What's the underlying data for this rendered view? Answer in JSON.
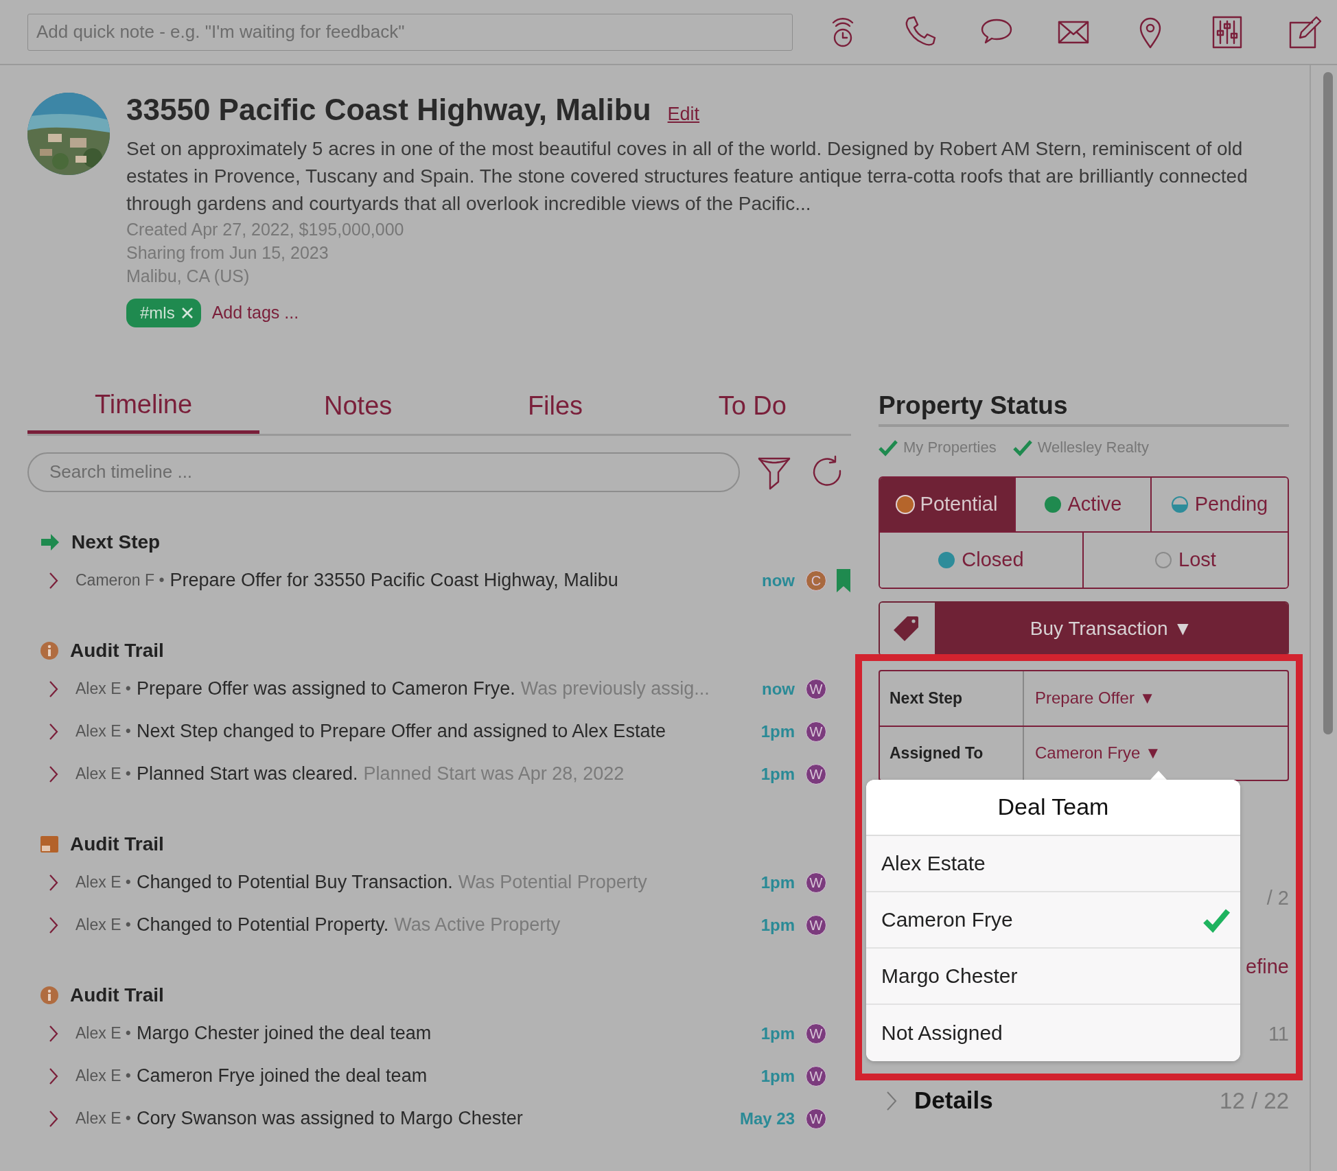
{
  "quick_note": {
    "placeholder": "Add quick note - e.g. \"I'm waiting for feedback\""
  },
  "property": {
    "title": "33550 Pacific Coast Highway, Malibu",
    "edit_link": "Edit",
    "description": "Set on approximately 5 acres in one of the most beautiful coves in all of the world. Designed by Robert AM Stern, reminiscent of old estates in Provence, Tuscany and Spain. The stone covered structures feature antique terra-cotta roofs that are brilliantly connected through gardens and courtyards that all overlook incredible views of the Pacific...",
    "meta": [
      "Created Apr 27, 2022, $195,000,000",
      "Sharing from Jun 15, 2023",
      "Malibu, CA (US)"
    ],
    "tags": [
      {
        "label": "#mls"
      }
    ],
    "add_tags": "Add tags ..."
  },
  "tabs": [
    {
      "label": "Timeline",
      "selected": true
    },
    {
      "label": "Notes",
      "selected": false
    },
    {
      "label": "Files",
      "selected": false
    },
    {
      "label": "To Do",
      "selected": false
    }
  ],
  "search": {
    "placeholder": "Search timeline ..."
  },
  "timeline": [
    {
      "kind": "next_step",
      "title": "Next Step",
      "rows": [
        {
          "author": "Cameron F •",
          "text": "Prepare Offer for 33550 Pacific Coast Highway, Malibu",
          "time": "now",
          "avatar": "C",
          "color": "#a8693f",
          "bookmarked": true
        }
      ]
    },
    {
      "kind": "info",
      "title": "Audit Trail",
      "rows": [
        {
          "author": "Alex E •",
          "text": "Prepare Offer was assigned to Cameron Frye.",
          "note": "Was previously assig...",
          "time": "now",
          "avatar": "W",
          "color": "#7b3b7d",
          "bookmarked": false
        },
        {
          "author": "Alex E •",
          "text": "Next Step changed to Prepare Offer and assigned to Alex Estate",
          "time": "1pm",
          "avatar": "W",
          "color": "#7b3b7d",
          "bookmarked": false
        },
        {
          "author": "Alex E •",
          "text": "Planned Start was cleared.",
          "note": "Planned Start was Apr 28, 2022",
          "time": "1pm",
          "avatar": "W",
          "color": "#7b3b7d",
          "bookmarked": false
        }
      ]
    },
    {
      "kind": "card",
      "title": "Audit Trail",
      "rows": [
        {
          "author": "Alex E •",
          "text": "Changed to Potential Buy Transaction.",
          "note": "Was Potential Property",
          "time": "1pm",
          "avatar": "W",
          "color": "#7b3b7d",
          "bookmarked": false
        },
        {
          "author": "Alex E •",
          "text": "Changed to Potential Property.",
          "note": "Was Active Property",
          "time": "1pm",
          "avatar": "W",
          "color": "#7b3b7d",
          "bookmarked": false
        }
      ]
    },
    {
      "kind": "info",
      "title": "Audit Trail",
      "rows": [
        {
          "author": "Alex E •",
          "text": "Margo Chester joined the deal team",
          "time": "1pm",
          "avatar": "W",
          "color": "#7b3b7d",
          "bookmarked": false
        },
        {
          "author": "Alex E •",
          "text": "Cameron Frye joined the deal team",
          "time": "1pm",
          "avatar": "W",
          "color": "#7b3b7d",
          "bookmarked": false
        },
        {
          "author": "Alex E •",
          "text": "Cory Swanson was assigned to Margo Chester",
          "time": "May 23",
          "avatar": "W",
          "color": "#7b3b7d",
          "bookmarked": false
        }
      ]
    }
  ],
  "status_panel": {
    "title": "Property Status",
    "lists": [
      {
        "label": "My Properties",
        "checked": true
      },
      {
        "label": "Wellesley Realty",
        "checked": true
      }
    ],
    "statuses": [
      {
        "label": "Potential",
        "kind": "full",
        "color": "#b5652b",
        "selected": true
      },
      {
        "label": "Active",
        "kind": "full",
        "color": "#1f8a4f",
        "selected": false
      },
      {
        "label": "Pending",
        "kind": "half",
        "color": "#2e8c9a",
        "selected": false
      },
      {
        "label": "Closed",
        "kind": "full",
        "color": "#2e8c9a",
        "selected": false
      },
      {
        "label": "Lost",
        "kind": "empty",
        "color": "#8a8a8a",
        "selected": false
      }
    ],
    "transaction": "Buy Transaction ▼",
    "fields": [
      {
        "label": "Next Step",
        "value": "Prepare Offer ▼"
      },
      {
        "label": "Assigned To",
        "value": "Cameron Frye ▼"
      }
    ],
    "peek_rows": [
      {
        "kind": "count",
        "text": "/ 2"
      },
      {
        "kind": "link",
        "text": "efine"
      },
      {
        "kind": "count",
        "text": "11"
      }
    ],
    "details": {
      "label": "Details",
      "count": "12 / 22"
    }
  },
  "popover": {
    "title": "Deal Team",
    "options": [
      {
        "label": "Alex Estate",
        "selected": false
      },
      {
        "label": "Cameron Frye",
        "selected": true
      },
      {
        "label": "Margo Chester",
        "selected": false
      },
      {
        "label": "Not Assigned",
        "selected": false
      }
    ]
  }
}
